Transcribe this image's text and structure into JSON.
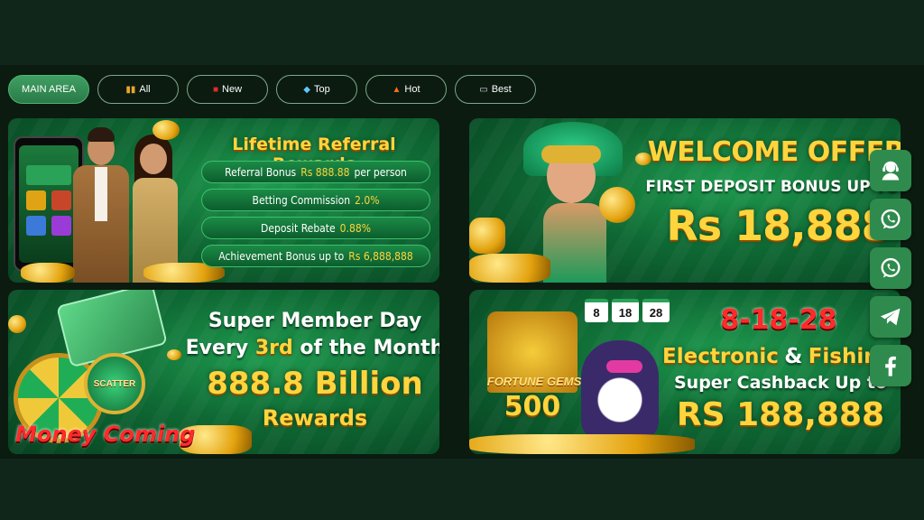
{
  "tabs": [
    {
      "label": "MAIN AREA",
      "icon": ""
    },
    {
      "label": "All",
      "icon": "grid-icon"
    },
    {
      "label": "New",
      "icon": "new-icon"
    },
    {
      "label": "Top",
      "icon": "diamond-icon"
    },
    {
      "label": "Hot",
      "icon": "fire-icon"
    },
    {
      "label": "Best",
      "icon": "tv-icon"
    }
  ],
  "referral": {
    "title": "Lifetime Referral Rewards",
    "rows": [
      {
        "label": "Referral Bonus",
        "value": "Rs 888.88",
        "suffix": "per person"
      },
      {
        "label": "Betting Commission",
        "value": "2.0%",
        "suffix": ""
      },
      {
        "label": "Deposit Rebate",
        "value": "0.88%",
        "suffix": ""
      },
      {
        "label": "Achievement Bonus up to",
        "value": "Rs 6,888,888",
        "suffix": ""
      }
    ]
  },
  "welcome": {
    "line1": "WELCOME OFFER",
    "line2": "FIRST DEPOSIT BONUS UP TO",
    "amount": "Rs 18,888"
  },
  "member_day": {
    "line1": "Super Member Day",
    "line2_pre": "Every",
    "line2_hl": "3rd",
    "line2_post": "of the Month",
    "line3": "888.8 Billion",
    "line4": "Rewards",
    "logo": "Money Coming",
    "scatter": "SCATTER"
  },
  "cashback": {
    "tiles": [
      "8",
      "18",
      "28"
    ],
    "line1": "8-18-28",
    "line2_a": "Electronic",
    "line2_b": "&",
    "line2_c": "Fishing",
    "line3": "Super Cashback Up to",
    "amount": "RS 188,888",
    "game_logo": "FORTUNE GEMS",
    "game_num": "500"
  },
  "side_buttons": [
    "support-agent-icon",
    "whatsapp-icon",
    "whatsapp-icon",
    "telegram-icon",
    "facebook-icon"
  ],
  "colors": {
    "accent": "#3fa063",
    "gold": "#ffd53d",
    "red": "#ff2a2a",
    "side_btn": "#2f8a4d"
  }
}
